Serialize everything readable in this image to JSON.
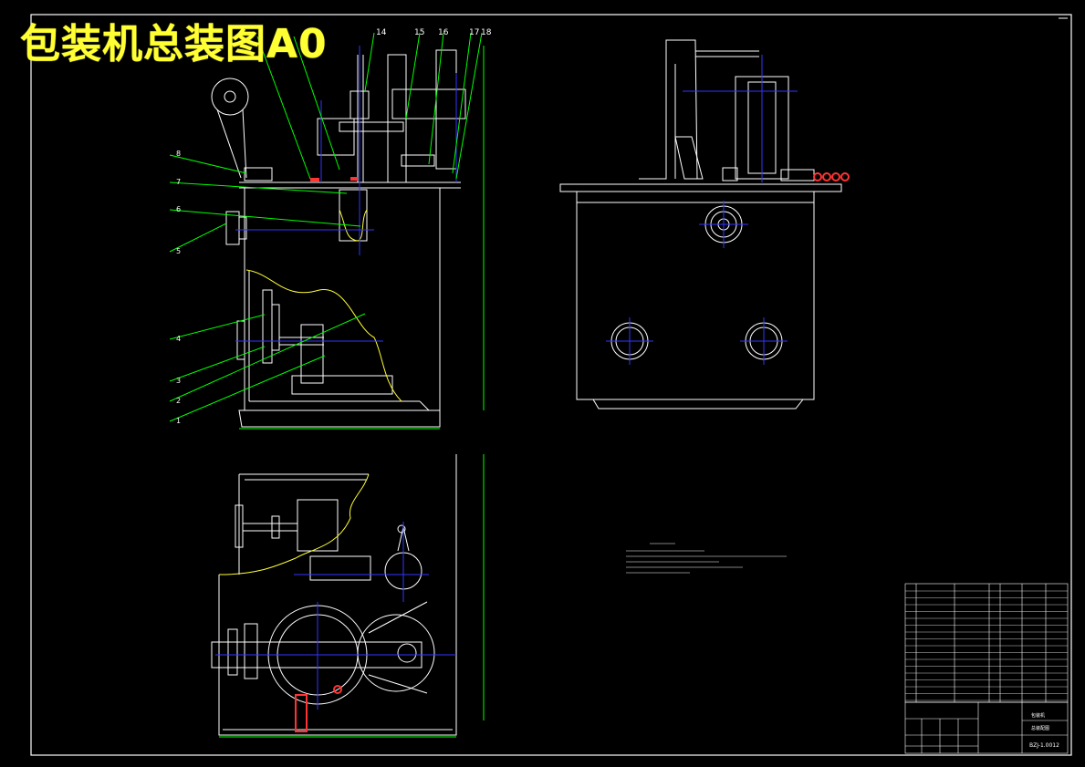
{
  "title": "包装机总装图A0",
  "balloons_top": [
    "14",
    "15",
    "16",
    "17",
    "18"
  ],
  "balloons_left": [
    "8",
    "7",
    "6",
    "5",
    "4",
    "3",
    "2",
    "1"
  ],
  "title_block": {
    "part_name": "包装机",
    "drawing_name": "总装配图",
    "drawing_no": "BZJ-1.0012"
  },
  "colors": {
    "background": "#000000",
    "outline": "#ffffff",
    "leader": "#00ff00",
    "center": "#3333ff",
    "hidden": "#ff3333",
    "title": "#ffff33"
  }
}
